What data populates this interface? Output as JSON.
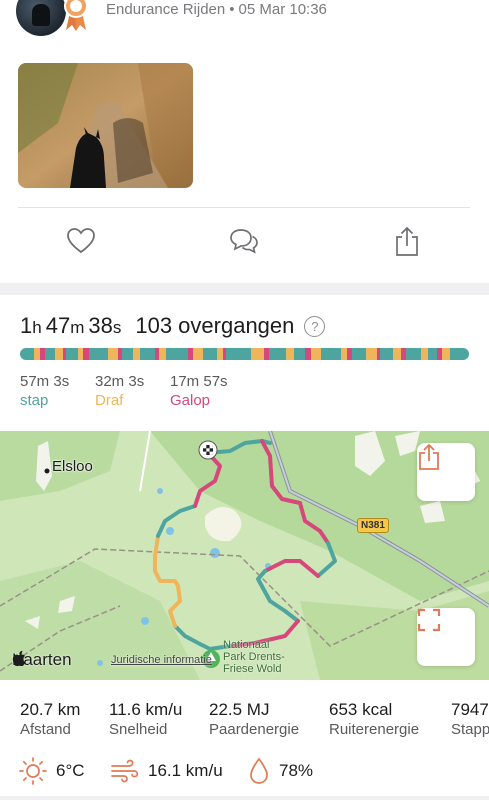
{
  "header": {
    "club": "Endurance Rijden",
    "date": "05 Mar 10:36"
  },
  "actions": {
    "like_icon": "heart-icon",
    "comment_icon": "comment-icon",
    "share_icon": "share-icon"
  },
  "summary": {
    "hours": "1",
    "hours_unit": "h",
    "minutes": "47",
    "minutes_unit": "m",
    "seconds": "38",
    "seconds_unit": "s",
    "transitions": "103 overgangen",
    "help": "?"
  },
  "gait_colors": {
    "stap": "#4ea49e",
    "draf": "#f0b55a",
    "galop": "#d6477c"
  },
  "gaits": [
    {
      "time": "57m 3s",
      "name": "stap",
      "color": "#4ea49e"
    },
    {
      "time": "32m 3s",
      "name": "Draf",
      "color": "#f0b55a"
    },
    {
      "time": "17m 57s",
      "name": "Galop",
      "color": "#d6477c"
    }
  ],
  "map": {
    "place_label": "Elsloo",
    "road_label": "N381",
    "park_label_1": "Nationaal",
    "park_label_2": "Park Drents-",
    "park_label_3": "Friese Wold",
    "brand": "Kaarten",
    "legal": "Juridische informatie",
    "share_icon": "share-icon",
    "expand_icon": "expand-icon"
  },
  "stats": [
    {
      "value": "20.7 km",
      "label": "Afstand"
    },
    {
      "value": "11.6 km/u",
      "label": "Snelheid"
    },
    {
      "value": "22.5 MJ",
      "label": "Paardenergie"
    },
    {
      "value": "653 kcal",
      "label": "Ruiterenergie"
    },
    {
      "value": "7947",
      "label": "Stappen"
    }
  ],
  "weather": {
    "temperature": "6°C",
    "wind": "16.1 km/u",
    "humidity": "78%"
  }
}
